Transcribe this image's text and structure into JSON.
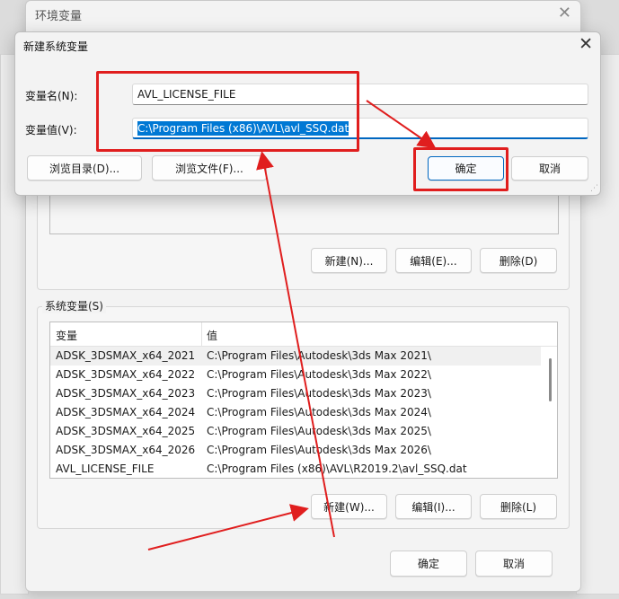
{
  "env_window": {
    "title": "环境变量",
    "user_buttons": {
      "new": "新建(N)...",
      "edit": "编辑(E)...",
      "delete": "删除(D)"
    },
    "system_group_label": "系统变量(S)",
    "system_table": {
      "headers": [
        "变量",
        "值"
      ],
      "rows": [
        [
          "ADSK_3DSMAX_x64_2021",
          "C:\\Program Files\\Autodesk\\3ds Max 2021\\"
        ],
        [
          "ADSK_3DSMAX_x64_2022",
          "C:\\Program Files\\Autodesk\\3ds Max 2022\\"
        ],
        [
          "ADSK_3DSMAX_x64_2023",
          "C:\\Program Files\\Autodesk\\3ds Max 2023\\"
        ],
        [
          "ADSK_3DSMAX_x64_2024",
          "C:\\Program Files\\Autodesk\\3ds Max 2024\\"
        ],
        [
          "ADSK_3DSMAX_x64_2025",
          "C:\\Program Files\\Autodesk\\3ds Max 2025\\"
        ],
        [
          "ADSK_3DSMAX_x64_2026",
          "C:\\Program Files\\Autodesk\\3ds Max 2026\\"
        ],
        [
          "AVL_LICENSE_FILE",
          "C:\\Program Files (x86)\\AVL\\R2019.2\\avl_SSQ.dat"
        ]
      ]
    },
    "system_buttons": {
      "new": "新建(W)...",
      "edit": "编辑(I)...",
      "delete": "删除(L)"
    },
    "footer_buttons": {
      "ok": "确定",
      "cancel": "取消"
    }
  },
  "dialog": {
    "title": "新建系统变量",
    "name_label": "变量名(N):",
    "name_value": "AVL_LICENSE_FILE",
    "value_label": "变量值(V):",
    "value_value": "C:\\Program Files (x86)\\AVL\\avl_SSQ.dat",
    "browse_dir": "浏览目录(D)...",
    "browse_file": "浏览文件(F)...",
    "ok": "确定",
    "cancel": "取消"
  },
  "close_glyph": "✕",
  "colors": {
    "annotation_red": "#e01e1e",
    "accent": "#0067c0",
    "selection": "#0078d4"
  }
}
